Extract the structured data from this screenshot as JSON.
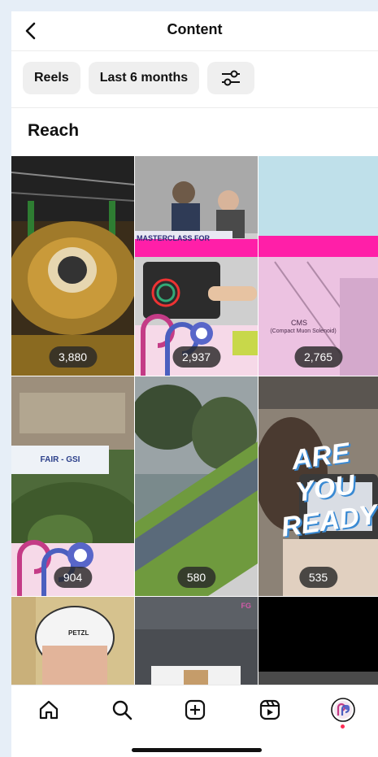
{
  "header": {
    "title": "Content"
  },
  "filters": [
    {
      "label": "Reels"
    },
    {
      "label": "Last 6 months"
    }
  ],
  "section": {
    "title": "Reach"
  },
  "posts": [
    {
      "reach": "3,880"
    },
    {
      "reach": "2,937",
      "overlay_text": "MASTERCLASS FOR"
    },
    {
      "reach": "2,765",
      "overlay_text": "CMS",
      "overlay_subtext": "(Compact Muon Solenoid)"
    },
    {
      "reach": "904",
      "overlay_text": "FAIR - GSI"
    },
    {
      "reach": "580"
    },
    {
      "reach": "535",
      "overlay_text": "ARE YOU READY?"
    },
    {
      "helmet_text": "PETZL"
    },
    {
      "corner_logo": "FG"
    },
    {}
  ],
  "tabbar": {
    "icons": [
      "home-icon",
      "search-icon",
      "create-icon",
      "reels-icon",
      "profile-avatar"
    ],
    "notification_dot_color": "#ff2d55"
  },
  "colors": {
    "accent_pink": "#ff1fa8",
    "badge_bg": "#282828"
  }
}
